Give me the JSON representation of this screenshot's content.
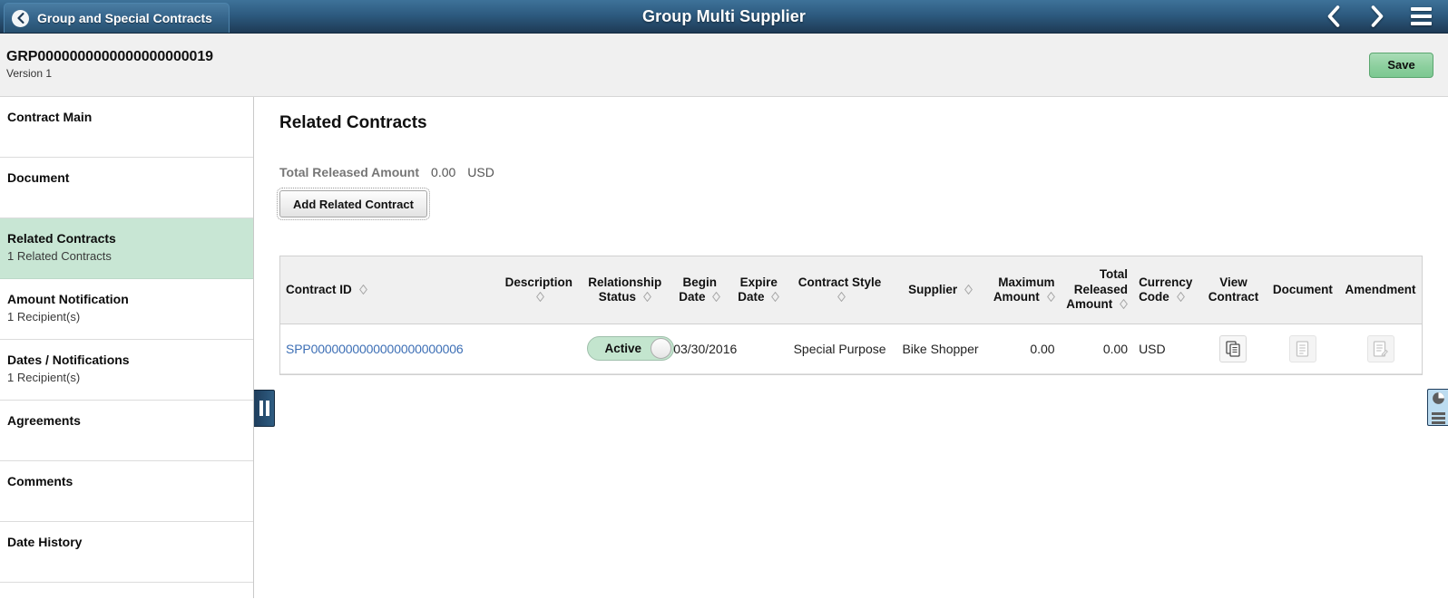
{
  "header": {
    "back_label": "Group and Special Contracts",
    "back_icon": "chevron-left-icon",
    "title": "Group Multi Supplier",
    "prev_icon": "chevron-left-icon",
    "next_icon": "chevron-right-icon",
    "menu_icon": "hamburger-menu-icon",
    "bg_gradient_top": "#3e7299",
    "bg_gradient_bottom": "#1e3a55"
  },
  "subheader": {
    "document_id": "GRP0000000000000000000019",
    "version": "Version 1",
    "save_label": "Save",
    "save_color": "#8ccf9e"
  },
  "sidebar": {
    "items": [
      {
        "label": "Contract Main",
        "sub": "",
        "active": false
      },
      {
        "label": "Document",
        "sub": "",
        "active": false
      },
      {
        "label": "Related Contracts",
        "sub": "1 Related Contracts",
        "active": true
      },
      {
        "label": "Amount Notification",
        "sub": "1 Recipient(s)",
        "active": false
      },
      {
        "label": "Dates / Notifications",
        "sub": "1 Recipient(s)",
        "active": false
      },
      {
        "label": "Agreements",
        "sub": "",
        "active": false
      },
      {
        "label": "Comments",
        "sub": "",
        "active": false
      },
      {
        "label": "Date History",
        "sub": "",
        "active": false
      }
    ],
    "active_bg": "#c8e6d4",
    "collapse_handle_icon": "pause-bars-icon"
  },
  "main": {
    "section_title": "Related Contracts",
    "total_released_label": "Total Released Amount",
    "total_released_value": "0.00",
    "total_released_currency": "USD",
    "add_button_label": "Add Related Contract"
  },
  "table": {
    "columns": [
      {
        "label": "Contract ID",
        "sortable": true
      },
      {
        "label": "Description",
        "sortable": true
      },
      {
        "label": "Relationship Status",
        "sortable": true
      },
      {
        "label": "Begin Date",
        "sortable": true
      },
      {
        "label": "Expire Date",
        "sortable": true
      },
      {
        "label": "Contract Style",
        "sortable": true
      },
      {
        "label": "Supplier",
        "sortable": true
      },
      {
        "label": "Maximum Amount",
        "sortable": true
      },
      {
        "label": "Total Released Amount",
        "sortable": true
      },
      {
        "label": "Currency Code",
        "sortable": true
      },
      {
        "label": "View Contract",
        "sortable": false
      },
      {
        "label": "Document",
        "sortable": false
      },
      {
        "label": "Amendment",
        "sortable": false
      }
    ],
    "rows": [
      {
        "contract_id": "SPP0000000000000000000006",
        "description": "",
        "relationship_status": "Active",
        "begin_date": "03/30/2016",
        "expire_date": "",
        "contract_style": "Special Purpose",
        "supplier": "Bike Shopper",
        "maximum_amount": "0.00",
        "total_released_amount": "0.00",
        "currency_code": "USD",
        "view_contract_icon": "copy-document-icon",
        "view_contract_enabled": true,
        "document_icon": "document-icon",
        "document_enabled": false,
        "amendment_icon": "document-edit-icon",
        "amendment_enabled": false
      }
    ]
  },
  "dock": {
    "tab_icon": "pie-chart-icon",
    "tab_color": "#bcdcf0"
  }
}
